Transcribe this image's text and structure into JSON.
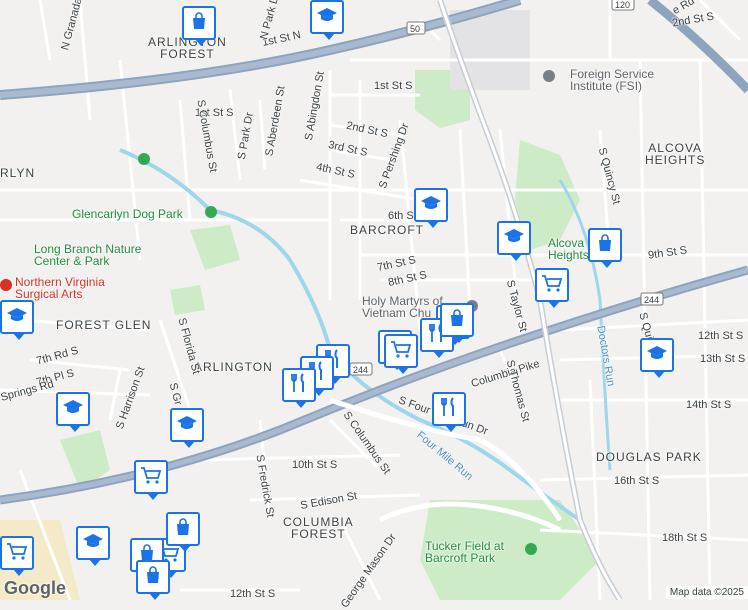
{
  "areas": {
    "arlington_forest": "ARLINGTON\nFOREST",
    "barcroft": "BARCROFT",
    "alcova_heights": "ALCOVA\nHEIGHTS",
    "glencarlyn": "RLYN",
    "forest_glen": "FOREST GLEN",
    "arlington": "ARLINGTON",
    "douglas_park": "DOUGLAS PARK",
    "columbia_forest": "COLUMBIA\nFOREST"
  },
  "pois": {
    "foreign_service": "Foreign Service\nInstitute (FSI)",
    "dog_park": "Glencarlyn Dog Park",
    "long_branch": "Long Branch Nature\nCenter & Park",
    "nova_surgical": "Northern Virginia\nSurgical Arts",
    "holy_martyrs": "Holy Martyrs of\nVietnam Chu",
    "tucker_field": "Tucker Field at\nBarcroft Park",
    "alcova_park": "Alcova\nHeights P"
  },
  "roads": {
    "columbia_pike": "Columbia Pike",
    "four_mile_run": "Four Mile Run",
    "s_four_mile_run_dr": "S Four Mile Run Dr",
    "doctors_run": "Doctors Run",
    "first_st_n": "1st St N",
    "first_st_s_top": "1st St S",
    "first_st_s_left": "1st St S",
    "second_st_s": "2nd St S",
    "second_st_s_tr": "2nd St S",
    "third_st_s": "3rd St S",
    "fourth_st_s": "4th St S",
    "sixth_st_s": "6th St S",
    "seventh_st_s": "7th St S",
    "eighth_st_s": "8th St S",
    "ninth_st_s": "9th St S",
    "tenth_st_s": "10th St S",
    "twelfth_st_s": "12th St S",
    "twelfth_st_s_b": "12th St S",
    "thirteenth_st_s": "13th St S",
    "fourteenth_st_s": "14th St S",
    "sixteenth_st_s": "16th St S",
    "eighteenth_st_s": "18th St S",
    "seventh_rd_s": "7th Rd S",
    "seventh_pl_s": "7th Pl S",
    "s_abingdon": "S Abingdon St",
    "s_pershing": "S Pershing Dr",
    "s_columbus_top": "S Columbus St",
    "s_columbus_bot": "S Columbus St",
    "s_park_dr": "S Park Dr",
    "s_aberdeen": "S Aberdeen St",
    "s_florida": "S Florida St",
    "s_harrison": "S Harrison St",
    "s_fredrick": "S Fredrick St",
    "s_edison": "S Edison St",
    "george_mason": "George Mason Dr",
    "s_taylor": "S Taylor St",
    "s_thomas": "S Thomas St",
    "s_quincy": "S Quincy St",
    "s_quincy_b": "S Qui",
    "n_granada": "N Granada",
    "n_park": "N Park Dr",
    "s_gr": "S Gr",
    "spr_rd": "Springs Rd",
    "de_rd": "e Rd",
    "rt50": "50",
    "rt120": "120",
    "rt244a": "244",
    "rt244b": "244"
  },
  "markers": [
    {
      "type": "shopping"
    },
    {
      "type": "education"
    },
    {
      "type": "education"
    },
    {
      "type": "education"
    },
    {
      "type": "shopping"
    },
    {
      "type": "grocery"
    },
    {
      "type": "education"
    },
    {
      "type": "education"
    },
    {
      "type": "education"
    },
    {
      "type": "grocery"
    },
    {
      "type": "restaurant"
    },
    {
      "type": "restaurant"
    },
    {
      "type": "shopping"
    },
    {
      "type": "restaurant"
    },
    {
      "type": "restaurant"
    },
    {
      "type": "grocery"
    },
    {
      "type": "restaurant"
    },
    {
      "type": "grocery"
    },
    {
      "type": "restaurant"
    },
    {
      "type": "education"
    },
    {
      "type": "education"
    },
    {
      "type": "grocery"
    },
    {
      "type": "shopping"
    },
    {
      "type": "grocery"
    },
    {
      "type": "shopping"
    },
    {
      "type": "shopping"
    }
  ],
  "attribution": {
    "logo": "Google",
    "copyright": "Map data ©2025"
  }
}
